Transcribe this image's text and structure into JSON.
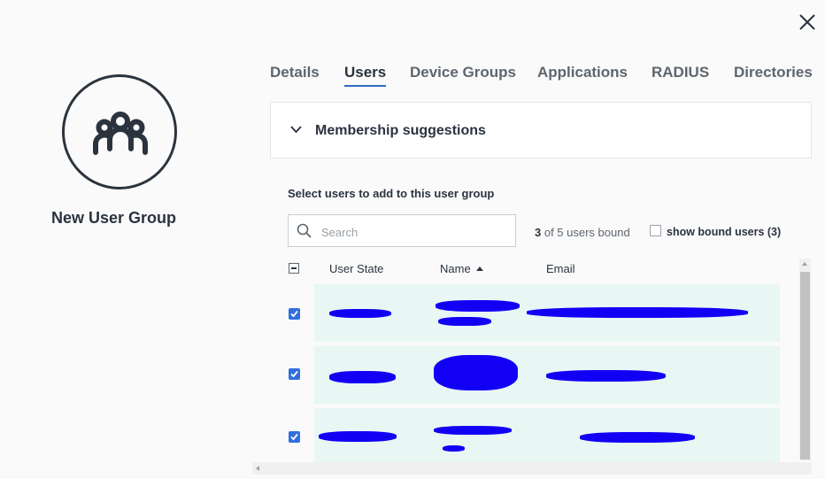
{
  "header": {
    "close_icon": "close-icon"
  },
  "group": {
    "icon": "users-group-icon",
    "name": "New User Group"
  },
  "tabs": [
    {
      "label": "Details",
      "active": false
    },
    {
      "label": "Users",
      "active": true
    },
    {
      "label": "Device Groups",
      "active": false
    },
    {
      "label": "Applications",
      "active": false
    },
    {
      "label": "RADIUS",
      "active": false
    },
    {
      "label": "Directories",
      "active": false
    }
  ],
  "suggestions": {
    "title": "Membership suggestions",
    "icon": "chevron-down-icon"
  },
  "users": {
    "select_label": "Select users to add to this user group",
    "search_placeholder": "Search",
    "bound_count_strong": "3",
    "bound_count_rest": " of 5 users bound",
    "show_bound_label": "show bound users (3)",
    "show_bound_checked": false
  },
  "table": {
    "columns": {
      "state": "User State",
      "name": "Name",
      "email": "Email"
    },
    "sort": {
      "column": "Name",
      "direction": "ascending"
    },
    "rows": [
      {
        "checked": true,
        "state": "",
        "name": "",
        "email": "",
        "redacted": true
      },
      {
        "checked": true,
        "state": "",
        "name": "",
        "email": "",
        "redacted": true
      },
      {
        "checked": true,
        "state": "",
        "name": "",
        "email": "",
        "redacted": true
      }
    ]
  },
  "colors": {
    "accent": "#2f6fe0",
    "row_selected_bg": "#e8f7f4",
    "redaction": "#1200f5",
    "text": "#2a3340"
  }
}
